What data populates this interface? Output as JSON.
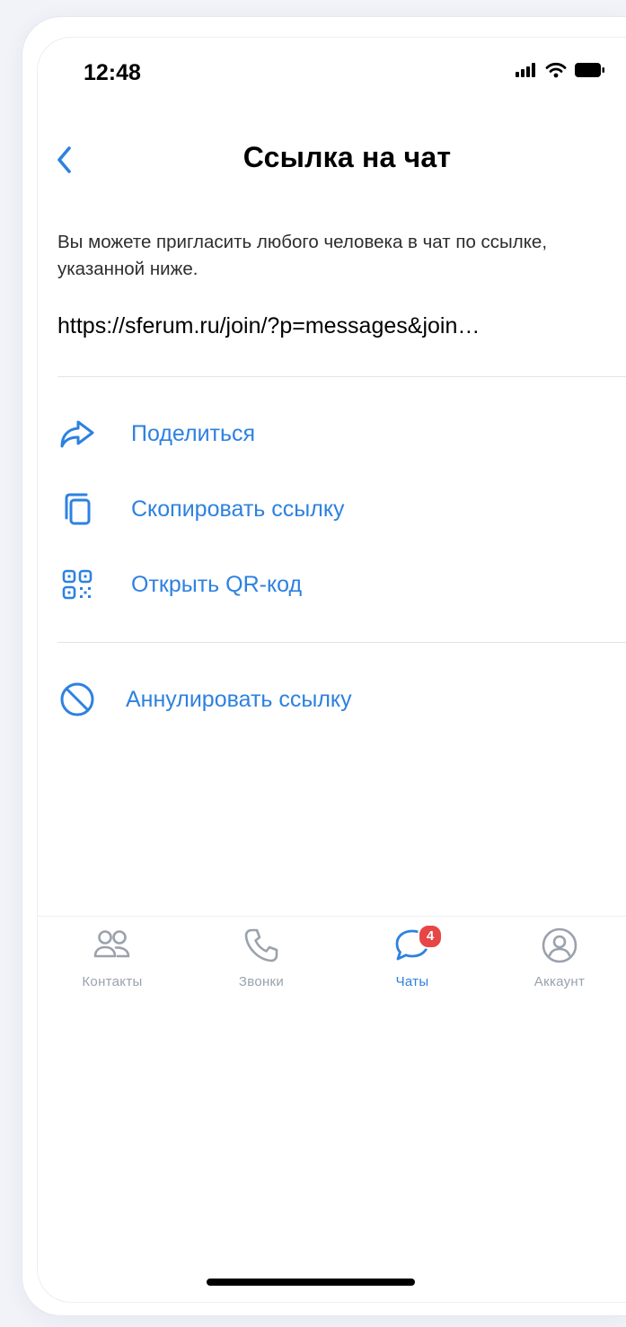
{
  "status_bar": {
    "time": "12:48"
  },
  "header": {
    "title": "Ссылка на чат"
  },
  "description": "Вы можете пригласить любого человека в чат по ссылке, указанной ниже.",
  "invite_link": "https://sferum.ru/join/?p=messages&join…",
  "actions": [
    {
      "label": "Поделиться",
      "icon": "share-icon"
    },
    {
      "label": "Скопировать ссылку",
      "icon": "copy-icon"
    },
    {
      "label": "Открыть QR-код",
      "icon": "qr-code-icon"
    }
  ],
  "revoke": {
    "label": "Аннулировать ссылку",
    "icon": "block-icon"
  },
  "tabbar": {
    "tabs": [
      {
        "label": "Контакты",
        "icon": "contacts-icon"
      },
      {
        "label": "Звонки",
        "icon": "phone-icon"
      },
      {
        "label": "Чаты",
        "icon": "chat-icon",
        "badge": "4",
        "active": true
      },
      {
        "label": "Аккаунт",
        "icon": "account-icon"
      }
    ]
  },
  "colors": {
    "accent": "#2d81e0",
    "badge": "#e64646",
    "inactive_tab": "#99a2ad",
    "background": "#f2f3f9"
  }
}
